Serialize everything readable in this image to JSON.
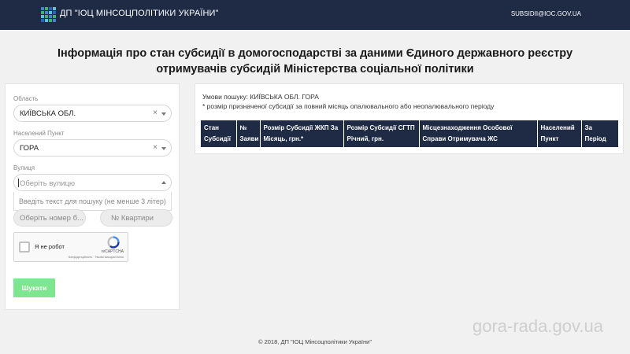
{
  "header": {
    "brand": "ДП \"ІОЦ МІНСОЦПОЛІТИКИ УКРАЇНИ\"",
    "email": "SUBSIDII@IOC.GOV.UA",
    "logo_colors": [
      "#4a7fd1",
      "#3fb56b",
      "#2c63b8",
      "#58c3e0",
      "#3fb56b",
      "#4a7fd1",
      "#58c3e0",
      "#2c63b8",
      "#58c3e0",
      "#3fb56b",
      "#4a7fd1",
      "#3fb56b",
      "#2c63b8",
      "#58c3e0",
      "#3fb56b",
      "#4a7fd1"
    ]
  },
  "title": {
    "line1": "Інформація про стан субсидії в домогосподарстві за даними Єдиного державного реєстру",
    "line2": "отримувачів субсидій Міністерства соціальної політики"
  },
  "form": {
    "region_label": "Область",
    "region_value": "КИЇВСЬКА ОБЛ.",
    "locality_label": "Населений Пункт",
    "locality_value": "ГОРА",
    "street_label": "Вулиця",
    "street_placeholder": "Оберіть вулицю",
    "street_hint": "Введіть текст для пошуку (не менше 3 літер)",
    "house_placeholder": "Оберіть номер б...",
    "apartment_placeholder": "№ Квартири",
    "clear_symbol": "×",
    "captcha": {
      "label": "Я не робот",
      "brand": "reCAPTCHA",
      "links": "Конфіденційність · Умови використання"
    },
    "search_button": "Шукати"
  },
  "results": {
    "conditions": "Умови пошуку: КИЇВСЬКА ОБЛ. ГОРА",
    "note": "* розмір призначеної субсидії за повний місяць опалювального або неопалювального періоду",
    "columns": [
      "Стан Субсидії",
      "№ Заяви",
      "Розмір Субсидії ЖКП За Місяць, грн.*",
      "Розмір Субсидії СГТП Річний, грн.",
      "Місцезнаходження Особової Справи Отримувача ЖС",
      "Населений Пункт",
      "За Період"
    ]
  },
  "footer": "© 2018, ДП \"ІОЦ Мінсоцполітики України\"",
  "watermark": "gora-rada.gov.ua",
  "colors": {
    "header_bg": "#1f2a44",
    "button": "#7ee68e",
    "page_bg": "#f1f1f1"
  }
}
